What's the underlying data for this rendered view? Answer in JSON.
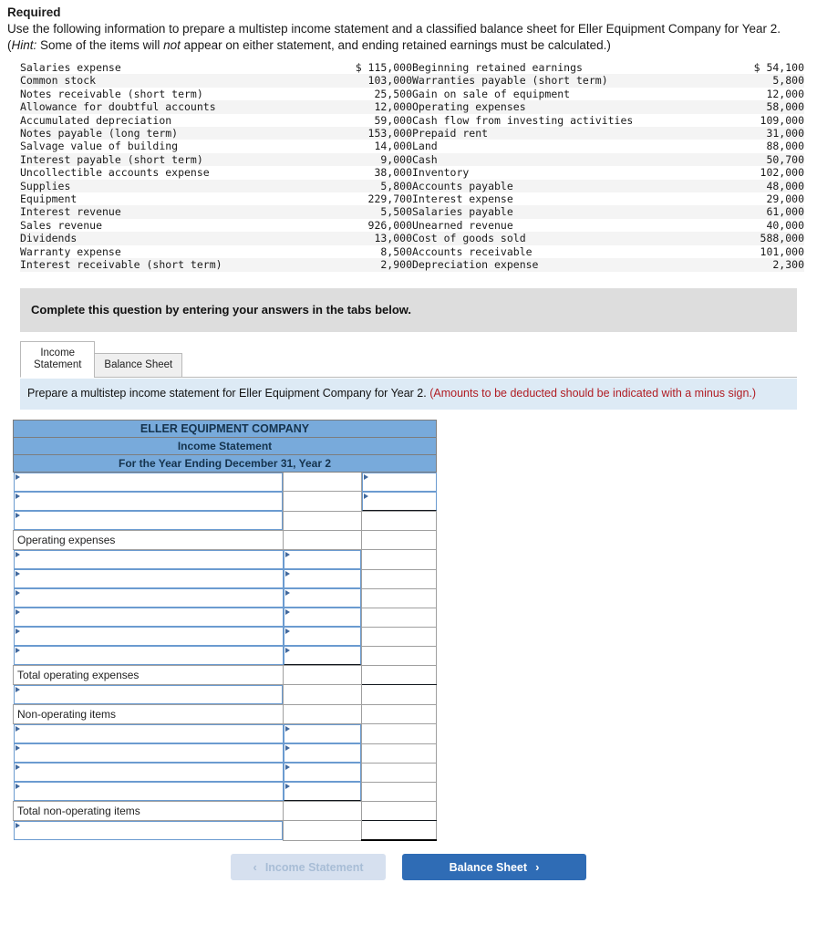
{
  "required": {
    "heading": "Required",
    "line1": "Use the following information to prepare a multistep income statement and a classified balance sheet for Eller Equipment Company for",
    "line2_a": "Year 2. (",
    "line2_hint": "Hint:",
    "line2_b": " Some of the items will ",
    "line2_not": "not",
    "line2_c": " appear on either statement, and ending retained earnings must be calculated.)"
  },
  "data_table": {
    "left": [
      {
        "label": "Salaries expense",
        "value": "$ 115,000"
      },
      {
        "label": "Common stock",
        "value": "103,000"
      },
      {
        "label": "Notes receivable (short term)",
        "value": "25,500"
      },
      {
        "label": "Allowance for doubtful accounts",
        "value": "12,000"
      },
      {
        "label": "Accumulated depreciation",
        "value": "59,000"
      },
      {
        "label": "Notes payable (long term)",
        "value": "153,000"
      },
      {
        "label": "Salvage value of building",
        "value": "14,000"
      },
      {
        "label": "Interest payable (short term)",
        "value": "9,000"
      },
      {
        "label": "Uncollectible accounts expense",
        "value": "38,000"
      },
      {
        "label": "Supplies",
        "value": "5,800"
      },
      {
        "label": "Equipment",
        "value": "229,700"
      },
      {
        "label": "Interest revenue",
        "value": "5,500"
      },
      {
        "label": "Sales revenue",
        "value": "926,000"
      },
      {
        "label": "Dividends",
        "value": "13,000"
      },
      {
        "label": "Warranty expense",
        "value": "8,500"
      },
      {
        "label": "Interest receivable (short term)",
        "value": "2,900"
      }
    ],
    "right": [
      {
        "label": "Beginning retained earnings",
        "value": "$ 54,100"
      },
      {
        "label": "Warranties payable (short term)",
        "value": "5,800"
      },
      {
        "label": "Gain on sale of equipment",
        "value": "12,000"
      },
      {
        "label": "Operating expenses",
        "value": "58,000"
      },
      {
        "label": "Cash flow from investing activities",
        "value": "109,000"
      },
      {
        "label": "Prepaid rent",
        "value": "31,000"
      },
      {
        "label": "Land",
        "value": "88,000"
      },
      {
        "label": "Cash",
        "value": "50,700"
      },
      {
        "label": "Inventory",
        "value": "102,000"
      },
      {
        "label": "Accounts payable",
        "value": "48,000"
      },
      {
        "label": "Interest expense",
        "value": "29,000"
      },
      {
        "label": "Salaries payable",
        "value": "61,000"
      },
      {
        "label": "Unearned revenue",
        "value": "40,000"
      },
      {
        "label": "Cost of goods sold",
        "value": "588,000"
      },
      {
        "label": "Accounts receivable",
        "value": "101,000"
      },
      {
        "label": "Depreciation expense",
        "value": "2,300"
      }
    ]
  },
  "instruction_bar": {
    "text": "Complete this question by entering your answers in the tabs below."
  },
  "tabs": [
    {
      "label": "Income Statement",
      "active": true
    },
    {
      "label": "Balance Sheet",
      "active": false
    }
  ],
  "tab_instruction": {
    "main": "Prepare a multistep income statement for Eller Equipment Company for Year 2.",
    "red": "(Amounts to be deducted should be indicated with a minus sign.)"
  },
  "statement": {
    "header": {
      "company": "ELLER EQUIPMENT COMPANY",
      "title": "Income Statement",
      "period": "For the Year Ending December 31, Year 2"
    },
    "rows": [
      {
        "label": "",
        "type": "dropdown",
        "mid": "blank",
        "right": "dropdown"
      },
      {
        "label": "",
        "type": "dropdown",
        "mid": "blank",
        "right": "dropdown-underline"
      },
      {
        "label": "",
        "type": "dropdown",
        "mid": "blank",
        "right": "blank"
      },
      {
        "label": "Operating expenses",
        "type": "static",
        "mid": "blank",
        "right": "blank"
      },
      {
        "label": "",
        "type": "dropdown",
        "mid": "dropdown",
        "right": "blank"
      },
      {
        "label": "",
        "type": "dropdown",
        "mid": "dropdown",
        "right": "blank"
      },
      {
        "label": "",
        "type": "dropdown",
        "mid": "dropdown",
        "right": "blank"
      },
      {
        "label": "",
        "type": "dropdown",
        "mid": "dropdown",
        "right": "blank"
      },
      {
        "label": "",
        "type": "dropdown",
        "mid": "dropdown",
        "right": "blank"
      },
      {
        "label": "",
        "type": "dropdown",
        "mid": "dropdown-underline",
        "right": "blank"
      },
      {
        "label": "Total operating expenses",
        "type": "static",
        "mid": "blank",
        "right": "blank-underline"
      },
      {
        "label": "",
        "type": "dropdown",
        "mid": "blank",
        "right": "blank"
      },
      {
        "label": "Non-operating items",
        "type": "static",
        "mid": "blank",
        "right": "blank"
      },
      {
        "label": "",
        "type": "dropdown",
        "mid": "dropdown",
        "right": "blank"
      },
      {
        "label": "",
        "type": "dropdown",
        "mid": "dropdown",
        "right": "blank"
      },
      {
        "label": "",
        "type": "dropdown",
        "mid": "dropdown",
        "right": "blank"
      },
      {
        "label": "",
        "type": "dropdown",
        "mid": "dropdown-underline",
        "right": "blank"
      },
      {
        "label": "Total non-operating items",
        "type": "static",
        "mid": "blank",
        "right": "blank-underline"
      },
      {
        "label": "",
        "type": "dropdown",
        "mid": "blank",
        "right": "blank-double"
      }
    ]
  },
  "nav": {
    "prev_label": "Income Statement",
    "prev_chevron": "‹",
    "next_label": "Balance Sheet",
    "next_chevron": "›"
  }
}
